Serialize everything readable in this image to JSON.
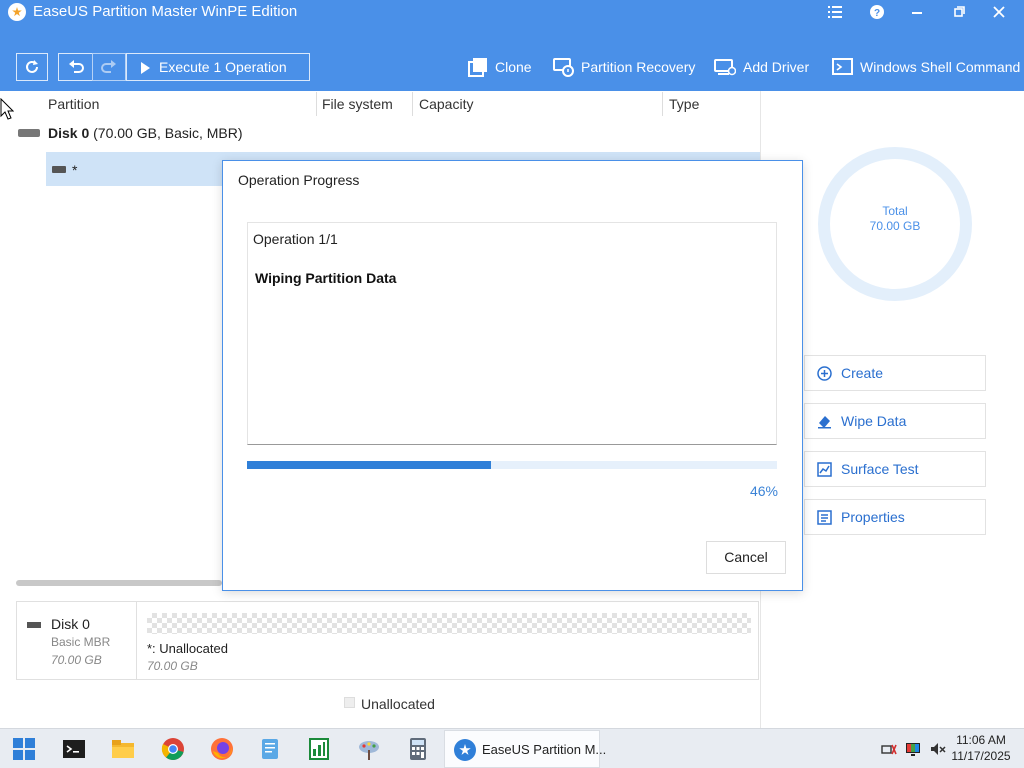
{
  "window": {
    "title": "EaseUS Partition Master WinPE Edition",
    "controls": [
      "menu-icon",
      "help-icon",
      "minimize-icon",
      "restore-icon",
      "close-icon"
    ]
  },
  "toolbar": {
    "refresh_icon": "refresh-icon",
    "undo_icon": "undo-icon",
    "redo_icon": "redo-icon",
    "execute_label": "Execute 1 Operation",
    "actions": [
      {
        "label": "Clone",
        "icon": "clone-icon"
      },
      {
        "label": "Partition Recovery",
        "icon": "partition-recovery-icon"
      },
      {
        "label": "Add Driver",
        "icon": "add-driver-icon"
      },
      {
        "label": "Windows Shell Command",
        "icon": "shell-icon"
      }
    ]
  },
  "table": {
    "columns": [
      "Partition",
      "File system",
      "Capacity",
      "Type"
    ],
    "disk": {
      "name": "Disk 0",
      "detail": "(70.00 GB, Basic, MBR)"
    },
    "partition": {
      "name": "*"
    }
  },
  "summary": {
    "label": "Total",
    "value": "70.00 GB"
  },
  "side_actions": [
    {
      "label": "Create",
      "icon": "create-icon"
    },
    {
      "label": "Wipe Data",
      "icon": "wipe-data-icon"
    },
    {
      "label": "Surface Test",
      "icon": "surface-test-icon"
    },
    {
      "label": "Properties",
      "icon": "properties-icon"
    }
  ],
  "disk_map": {
    "disk_name": "Disk 0",
    "disk_type": "Basic MBR",
    "disk_size": "70.00 GB",
    "partition_name": "*: Unallocated",
    "partition_size": "70.00 GB",
    "legend": "Unallocated"
  },
  "dialog": {
    "title": "Operation Progress",
    "operation_count": "Operation 1/1",
    "operation_name": "Wiping Partition Data",
    "progress": 0.46,
    "progress_label": "46%",
    "cancel_label": "Cancel"
  },
  "taskbar": {
    "apps": [
      "start-icon",
      "terminal-icon",
      "file-explorer-icon",
      "chrome-icon",
      "firefox-icon",
      "notepad-icon",
      "spreadsheet-icon",
      "paint-icon",
      "calculator-icon"
    ],
    "active_app": "EaseUS Partition M...",
    "time": "11:06 AM",
    "date": "11/17/2025"
  },
  "colors": {
    "accent": "#4a90e8",
    "progress": "#2f7fd8",
    "selection": "#cfe3f7"
  }
}
